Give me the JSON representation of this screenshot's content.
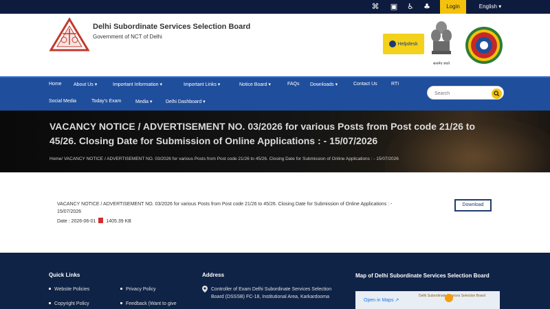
{
  "topbar": {
    "icons": [
      "sitemap-icon",
      "accessibility-icon",
      "screen-reader-icon",
      "contrast-icon"
    ],
    "login_label": "Login",
    "language_label": "English ▾"
  },
  "header": {
    "org_name": "Delhi Subordinate Services Selection Board",
    "org_sub": "Government of NCT of Delhi",
    "helpdesk_label": "Helpdesk",
    "emblem_caption": "सत्यमेव जयते",
    "colors": {
      "brand_blue": "#1f4e9c",
      "accent_yellow": "#f4c20d",
      "footer_navy": "#0f2347"
    }
  },
  "nav": {
    "row1": [
      "Home",
      "About Us ▾",
      "Important Information ▾",
      "Important Links ▾",
      "Notice Board ▾",
      "FAQs",
      "Downloads ▾",
      "Contact Us",
      "RTI"
    ],
    "row2": [
      "Social Media",
      "Today's Exam",
      "Media ▾",
      "Delhi Dashboard ▾"
    ],
    "search_placeholder": "Search"
  },
  "banner": {
    "title": "VACANCY NOTICE / ADVERTISEMENT NO. 03/2026 for various Posts from Post code 21/26 to 45/26. Closing Date for Submission of Online Applications : - 15/07/2026",
    "breadcrumb": "Home/ VACANCY NOTICE / ADVERTISEMENT NO. 03/2026 for various Posts from Post code 21/26 to 45/26. Closing Date for Submission of Online Applications : - 15/07/2026"
  },
  "notice": {
    "text": "VACANCY NOTICE / ADVERTISEMENT NO. 03/2026 for various Posts from Post code 21/26 to 45/26. Closing Date for Submission of Online Applications : - 15/07/2026",
    "date_label": "Date : 2026-06-01",
    "size_label": "1405.39 KB",
    "download_label": "Download"
  },
  "footer": {
    "quick_links_title": "Quick Links",
    "quick_links": [
      "Website Policies",
      "Privacy Policy",
      "Copyright Policy",
      "Feedback (Want to give"
    ],
    "address_title": "Address",
    "address_text": "Controller of Exam Delhi Subordinate Services Selection Board (DSSSB) FC-18, Institutional Area, Karkardooma",
    "map_title": "Map of Delhi Subordinate Services Selection Board",
    "map_link": "Open in Maps ↗",
    "map_place": "Delhi Subordinate Services Selection Board"
  }
}
